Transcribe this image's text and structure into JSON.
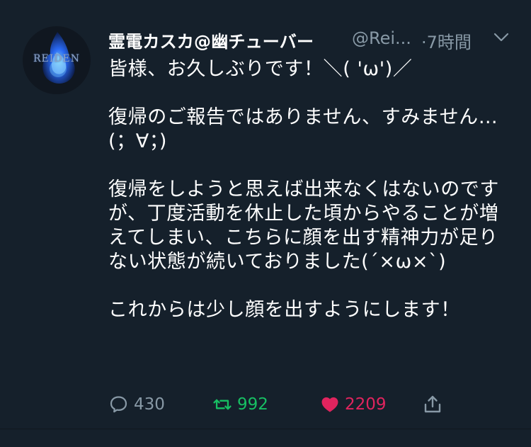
{
  "tweet": {
    "display_name": "霊電カスカ@幽チューバー",
    "username": "@Rei...",
    "time": "·7時間",
    "avatar_text": "REIDEN",
    "content": "皆様、お久しぶりです！＼( 'ω')／\n\n復帰のご報告ではありません、すみません…(；∀；)\n\n復帰をしようと思えば出来なくはないのですが、丁度活動を休止した頃からやることが増えてしまい、こちらに顔を出す精神力が足りない状態が続いておりました(´×ω×`)\n\nこれからは少し顔を出すようにします！"
  },
  "actions": {
    "reply_count": "430",
    "retweet_count": "992",
    "like_count": "2209"
  },
  "colors": {
    "background": "#15202b",
    "secondary_text": "#8899a6",
    "retweet_green": "#17bf63",
    "like_pink": "#e0245e",
    "accent_blue": "#1da1f2"
  },
  "icons": {
    "avatar": "spirit-flame-avatar",
    "more": "chevron-down-icon",
    "reply": "comment-icon",
    "retweet": "retweet-icon",
    "like": "heart-icon",
    "share": "share-icon"
  }
}
